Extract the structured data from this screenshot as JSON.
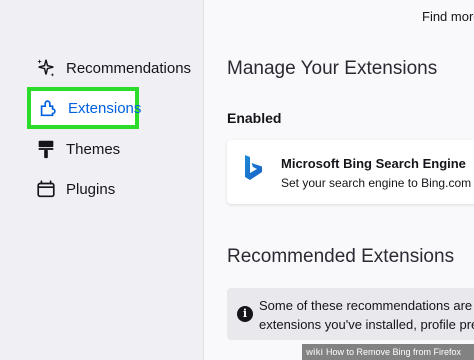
{
  "sidebar": {
    "items": [
      {
        "label": "Recommendations",
        "icon": "sparkles-icon"
      },
      {
        "label": "Extensions",
        "icon": "puzzle-icon"
      },
      {
        "label": "Themes",
        "icon": "paintbrush-icon"
      },
      {
        "label": "Plugins",
        "icon": "plugin-icon"
      }
    ],
    "highlight_color": "#2bdc2b",
    "active_color": "#0061e0"
  },
  "header": {
    "find_more": "Find more"
  },
  "main": {
    "title": "Manage Your Extensions",
    "enabled_heading": "Enabled",
    "extension": {
      "name": "Microsoft Bing Search Engine",
      "description": "Set your search engine to Bing.com",
      "icon": "bing-logo-icon"
    },
    "recommended_heading": "Recommended Extensions",
    "notice_line1": "Some of these recommendations are pe",
    "notice_line2": "extensions you've installed, profile pre"
  },
  "watermark": {
    "prefix": "wiki",
    "text": "How to Remove Bing from Firefox"
  }
}
